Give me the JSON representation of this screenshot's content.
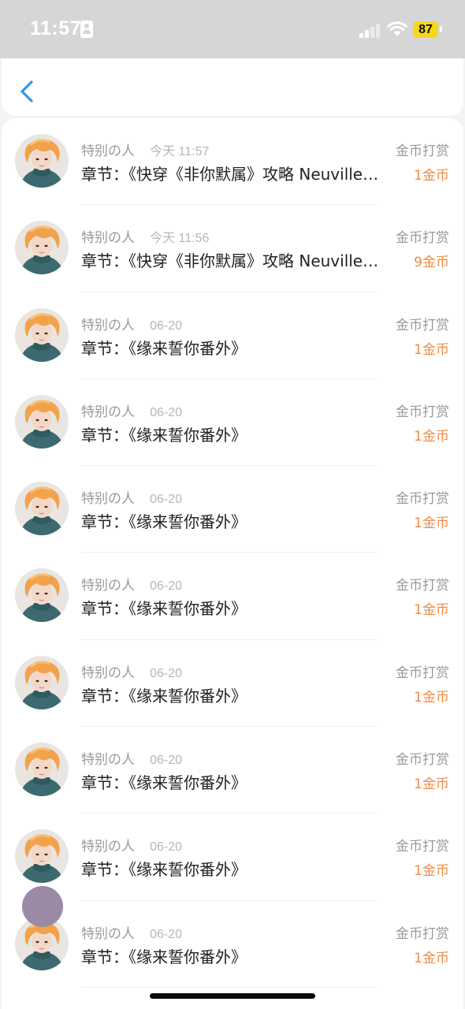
{
  "status_bar": {
    "time": "11:57",
    "battery": "87"
  },
  "nav": {
    "back_icon": "chevron-left-icon"
  },
  "colors": {
    "accent": "#2f9be6",
    "amount": "#f08a45",
    "secondary_text": "#999999"
  },
  "records": [
    {
      "user": "特别の人",
      "time": "今天 11:57",
      "chapter": "章节：《快穿《非你默属》攻略 Neuvillette》",
      "type": "金币打赏",
      "amount": "1金币"
    },
    {
      "user": "特别の人",
      "time": "今天 11:56",
      "chapter": "章节：《快穿《非你默属》攻略 Neuvillette》",
      "type": "金币打赏",
      "amount": "9金币"
    },
    {
      "user": "特别の人",
      "time": "06-20",
      "chapter": "章节：《缘来誓你番外》",
      "type": "金币打赏",
      "amount": "1金币"
    },
    {
      "user": "特别の人",
      "time": "06-20",
      "chapter": "章节：《缘来誓你番外》",
      "type": "金币打赏",
      "amount": "1金币"
    },
    {
      "user": "特别の人",
      "time": "06-20",
      "chapter": "章节：《缘来誓你番外》",
      "type": "金币打赏",
      "amount": "1金币"
    },
    {
      "user": "特别の人",
      "time": "06-20",
      "chapter": "章节：《缘来誓你番外》",
      "type": "金币打赏",
      "amount": "1金币"
    },
    {
      "user": "特别の人",
      "time": "06-20",
      "chapter": "章节：《缘来誓你番外》",
      "type": "金币打赏",
      "amount": "1金币"
    },
    {
      "user": "特别の人",
      "time": "06-20",
      "chapter": "章节：《缘来誓你番外》",
      "type": "金币打赏",
      "amount": "1金币"
    },
    {
      "user": "特别の人",
      "time": "06-20",
      "chapter": "章节：《缘来誓你番外》",
      "type": "金币打赏",
      "amount": "1金币"
    },
    {
      "user": "特别の人",
      "time": "06-20",
      "chapter": "章节：《缘来誓你番外》",
      "type": "金币打赏",
      "amount": "1金币"
    }
  ]
}
